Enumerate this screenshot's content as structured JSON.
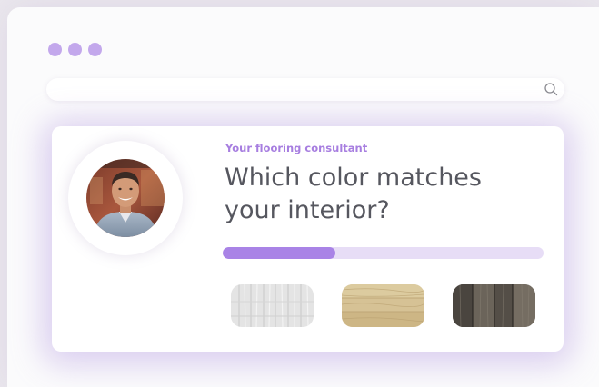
{
  "window": {
    "traffic_lights": [
      "dot",
      "dot",
      "dot"
    ],
    "accent_color": "#c3a8ec"
  },
  "search": {
    "placeholder": "",
    "icon": "search-icon"
  },
  "consultant": {
    "subtitle": "Your flooring consultant",
    "question": "Which color matches your interior?",
    "avatar": "consultant-portrait",
    "progress": 0.35,
    "progress_color": "#a983e6",
    "progress_track_color": "#e7ddf6",
    "options": [
      {
        "name": "white-wood",
        "color": "#e3e3e3"
      },
      {
        "name": "natural-oak",
        "color": "#d4c094"
      },
      {
        "name": "dark-weathered-wood",
        "color": "#5a544c"
      }
    ]
  }
}
